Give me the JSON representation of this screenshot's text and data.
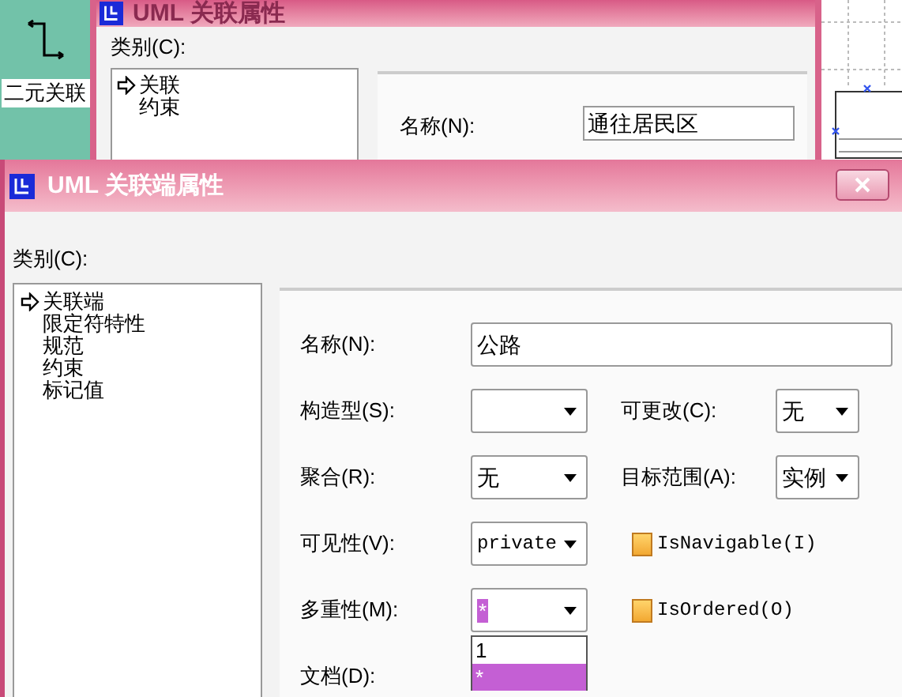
{
  "toolbar": {
    "tool_label": "二元关联"
  },
  "back_window": {
    "title": "UML 关联属性",
    "category_label": "类别(C):",
    "categories": [
      {
        "label": "关联",
        "selected": true
      },
      {
        "label": "约束",
        "selected": false
      }
    ],
    "name": {
      "label": "名称(N):",
      "value": "通往居民区"
    }
  },
  "dialog": {
    "title": "UML 关联端属性",
    "category_label": "类别(C):",
    "categories": [
      {
        "label": "关联端",
        "selected": true
      },
      {
        "label": "限定符特性",
        "selected": false
      },
      {
        "label": "规范",
        "selected": false
      },
      {
        "label": "约束",
        "selected": false
      },
      {
        "label": "标记值",
        "selected": false
      }
    ],
    "name": {
      "label": "名称(N):",
      "value": "公路"
    },
    "stereotype": {
      "label": "构造型(S):"
    },
    "changeable": {
      "label": "可更改(C):",
      "value": "无"
    },
    "aggregation": {
      "label": "聚合(R):",
      "value": "无"
    },
    "target_scope": {
      "label": "目标范围(A):",
      "value": "实例"
    },
    "visibility": {
      "label": "可见性(V):",
      "value": "private"
    },
    "is_navigable": {
      "label": "IsNavigable(I)",
      "checked": false
    },
    "multiplicity": {
      "label": "多重性(M):",
      "value": "*",
      "options": [
        {
          "label": "1",
          "selected": false
        },
        {
          "label": "*",
          "selected": true
        }
      ]
    },
    "is_ordered": {
      "label": "IsOrdered(O)",
      "checked": false
    },
    "documentation": {
      "label": "文档(D):"
    }
  }
}
